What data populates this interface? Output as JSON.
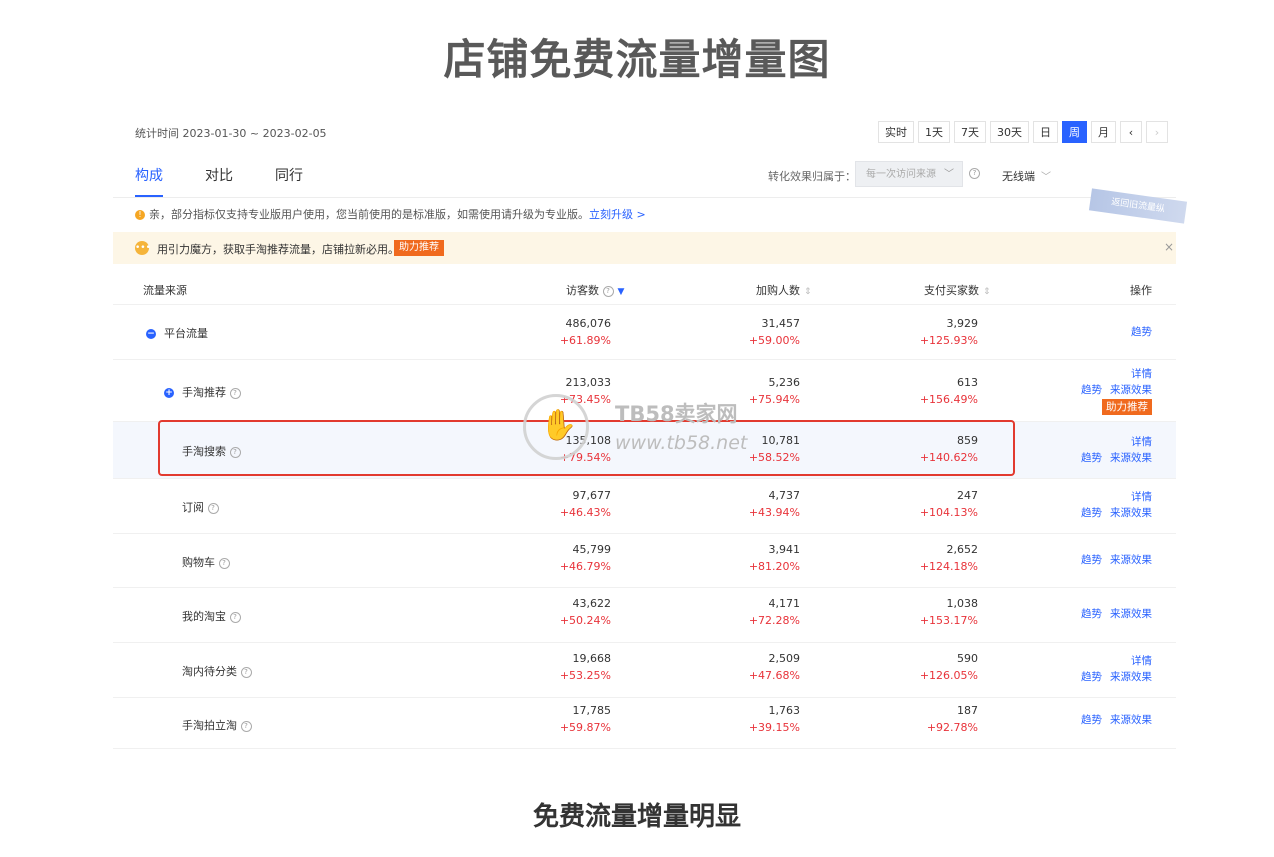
{
  "page_title": "店铺免费流量增量图",
  "footer_caption": "免费流量增量明显",
  "stat_range": "统计时间 2023-01-30 ~ 2023-02-05",
  "range_buttons": [
    "实时",
    "1天",
    "7天",
    "30天",
    "日",
    "周",
    "月",
    "‹",
    "›"
  ],
  "range_active": "周",
  "tabs": [
    "构成",
    "对比",
    "同行"
  ],
  "attribution_label": "转化效果归属于：",
  "attribution_value": "每一次访问来源",
  "device_value": "无线端",
  "corner_banner": "返回旧流量纵",
  "notice": {
    "text": "亲，部分指标仅支持专业版用户使用，您当前使用的是标准版，如需使用请升级为专业版。",
    "link": "立刻升级 >"
  },
  "promo": {
    "text": "用引力魔方，获取手淘推荐流量，店铺拉新必用。",
    "cta": "助力推荐",
    "close": "×"
  },
  "columns": {
    "source": "流量来源",
    "visitors": "访客数",
    "cart": "加购人数",
    "buyers": "支付买家数",
    "ops": "操作"
  },
  "rows": [
    {
      "name": "平台流量",
      "visitors": "486,076",
      "visitors_pct": "+61.89%",
      "cart": "31,457",
      "cart_pct": "+59.00%",
      "buyers": "3,929",
      "buyers_pct": "+125.93%",
      "ops": [
        "趋势"
      ]
    },
    {
      "name": "手淘推荐",
      "visitors": "213,033",
      "visitors_pct": "+73.45%",
      "cart": "5,236",
      "cart_pct": "+75.94%",
      "buyers": "613",
      "buyers_pct": "+156.49%",
      "ops": [
        "详情",
        "趋势",
        "来源效果",
        "助力推荐"
      ]
    },
    {
      "name": "手淘搜索",
      "visitors": "135,108",
      "visitors_pct": "+79.54%",
      "cart": "10,781",
      "cart_pct": "+58.52%",
      "buyers": "859",
      "buyers_pct": "+140.62%",
      "ops": [
        "详情",
        "趋势",
        "来源效果"
      ]
    },
    {
      "name": "订阅",
      "visitors": "97,677",
      "visitors_pct": "+46.43%",
      "cart": "4,737",
      "cart_pct": "+43.94%",
      "buyers": "247",
      "buyers_pct": "+104.13%",
      "ops": [
        "详情",
        "趋势",
        "来源效果"
      ]
    },
    {
      "name": "购物车",
      "visitors": "45,799",
      "visitors_pct": "+46.79%",
      "cart": "3,941",
      "cart_pct": "+81.20%",
      "buyers": "2,652",
      "buyers_pct": "+124.18%",
      "ops": [
        "趋势",
        "来源效果"
      ]
    },
    {
      "name": "我的淘宝",
      "visitors": "43,622",
      "visitors_pct": "+50.24%",
      "cart": "4,171",
      "cart_pct": "+72.28%",
      "buyers": "1,038",
      "buyers_pct": "+153.17%",
      "ops": [
        "趋势",
        "来源效果"
      ]
    },
    {
      "name": "淘内待分类",
      "visitors": "19,668",
      "visitors_pct": "+53.25%",
      "cart": "2,509",
      "cart_pct": "+47.68%",
      "buyers": "590",
      "buyers_pct": "+126.05%",
      "ops": [
        "详情",
        "趋势",
        "来源效果"
      ]
    },
    {
      "name": "手淘拍立淘",
      "visitors": "17,785",
      "visitors_pct": "+59.87%",
      "cart": "1,763",
      "cart_pct": "+39.15%",
      "buyers": "187",
      "buyers_pct": "+92.78%",
      "ops": [
        "趋势",
        "来源效果"
      ]
    }
  ],
  "watermark": {
    "brand": "TB58卖家网",
    "url": "www.tb58.net"
  },
  "colors": {
    "accent": "#2962ff",
    "positive": "#e8333a",
    "cta": "#f06a1e",
    "highlight_box": "#e23a2f"
  }
}
